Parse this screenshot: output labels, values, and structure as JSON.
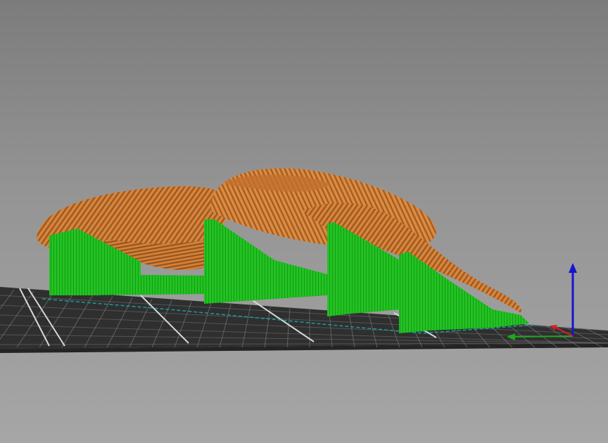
{
  "viewer": {
    "background_top": "#7c7c7c",
    "background_bottom": "#a6a6a6",
    "bed_color": "#2f2f2f",
    "grid_line_color": "#8a8a8a",
    "model_color": "#d9843a",
    "model_stripe_color": "#9a5a24",
    "support_color": "#22c322",
    "axis_x_color": "#d62020",
    "axis_y_color": "#1fa61f",
    "axis_z_color": "#1515d0"
  },
  "scene": {
    "objects": [
      {
        "type": "print-bed",
        "icon": "bed-plate"
      },
      {
        "type": "sliced-model",
        "icon": "layered-model"
      },
      {
        "type": "support-structure",
        "count": 4
      },
      {
        "type": "axis-gizmo",
        "axes": [
          "x",
          "y",
          "z"
        ]
      }
    ]
  }
}
